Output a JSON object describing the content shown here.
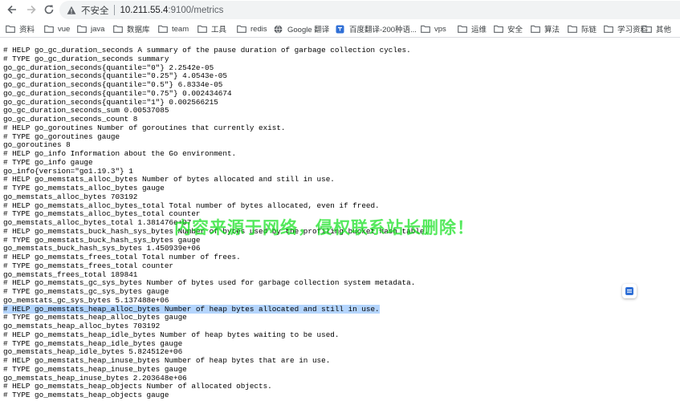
{
  "toolbar": {
    "security_label": "不安全",
    "url_host": "10.211.55.4",
    "url_path": ":9100/metrics"
  },
  "bookmarks": [
    {
      "label": "资料",
      "icon": "folder-icon"
    },
    {
      "label": "vue",
      "icon": "folder-icon"
    },
    {
      "label": "java",
      "icon": "folder-icon"
    },
    {
      "label": "数据库",
      "icon": "folder-icon"
    },
    {
      "label": "team",
      "icon": "folder-icon"
    },
    {
      "label": "工具",
      "icon": "folder-icon"
    },
    {
      "label": "redis",
      "icon": "folder-icon"
    },
    {
      "label": "Google 翻译",
      "icon": "globe-icon"
    },
    {
      "label": "百度翻译-200种语...",
      "icon": "translate-icon"
    },
    {
      "label": "vps",
      "icon": "folder-icon"
    },
    {
      "label": "运维",
      "icon": "folder-icon"
    },
    {
      "label": "安全",
      "icon": "folder-icon"
    },
    {
      "label": "算法",
      "icon": "folder-icon"
    },
    {
      "label": "际链",
      "icon": "folder-icon"
    },
    {
      "label": "学习资料",
      "icon": "folder-icon"
    },
    {
      "label": "其他",
      "icon": "folder-icon"
    }
  ],
  "metrics_lines": [
    "# HELP go_gc_duration_seconds A summary of the pause duration of garbage collection cycles.",
    "# TYPE go_gc_duration_seconds summary",
    "go_gc_duration_seconds{quantile=\"0\"} 2.2542e-05",
    "go_gc_duration_seconds{quantile=\"0.25\"} 4.0543e-05",
    "go_gc_duration_seconds{quantile=\"0.5\"} 6.8334e-05",
    "go_gc_duration_seconds{quantile=\"0.75\"} 0.002434674",
    "go_gc_duration_seconds{quantile=\"1\"} 0.002566215",
    "go_gc_duration_seconds_sum 0.00537085",
    "go_gc_duration_seconds_count 8",
    "# HELP go_goroutines Number of goroutines that currently exist.",
    "# TYPE go_goroutines gauge",
    "go_goroutines 8",
    "# HELP go_info Information about the Go environment.",
    "# TYPE go_info gauge",
    "go_info{version=\"go1.19.3\"} 1",
    "# HELP go_memstats_alloc_bytes Number of bytes allocated and still in use.",
    "# TYPE go_memstats_alloc_bytes gauge",
    "go_memstats_alloc_bytes 703192",
    "# HELP go_memstats_alloc_bytes_total Total number of bytes allocated, even if freed.",
    "# TYPE go_memstats_alloc_bytes_total counter",
    "go_memstats_alloc_bytes_total 1.381476e+07",
    "# HELP go_memstats_buck_hash_sys_bytes Number of bytes used by the profiling bucket hash table.",
    "# TYPE go_memstats_buck_hash_sys_bytes gauge",
    "go_memstats_buck_hash_sys_bytes 1.450939e+06",
    "# HELP go_memstats_frees_total Total number of frees.",
    "# TYPE go_memstats_frees_total counter",
    "go_memstats_frees_total 189841",
    "# HELP go_memstats_gc_sys_bytes Number of bytes used for garbage collection system metadata.",
    "# TYPE go_memstats_gc_sys_bytes gauge",
    "go_memstats_gc_sys_bytes 5.137488e+06",
    "# HELP go_memstats_heap_alloc_bytes Number of heap bytes allocated and still in use.",
    "# TYPE go_memstats_heap_alloc_bytes gauge",
    "go_memstats_heap_alloc_bytes 703192",
    "# HELP go_memstats_heap_idle_bytes Number of heap bytes waiting to be used.",
    "# TYPE go_memstats_heap_idle_bytes gauge",
    "go_memstats_heap_idle_bytes 5.824512e+06",
    "# HELP go_memstats_heap_inuse_bytes Number of heap bytes that are in use.",
    "# TYPE go_memstats_heap_inuse_bytes gauge",
    "go_memstats_heap_inuse_bytes 2.203648e+06",
    "# HELP go_memstats_heap_objects Number of allocated objects.",
    "# TYPE go_memstats_heap_objects gauge"
  ],
  "selected_line_index": 30,
  "watermark": "内容来源于网络，侵权联系站长删除！",
  "colors": {
    "selection": "#b4d5fd",
    "watermark": "#14e11e",
    "omnibox": "#f1f3f4"
  }
}
